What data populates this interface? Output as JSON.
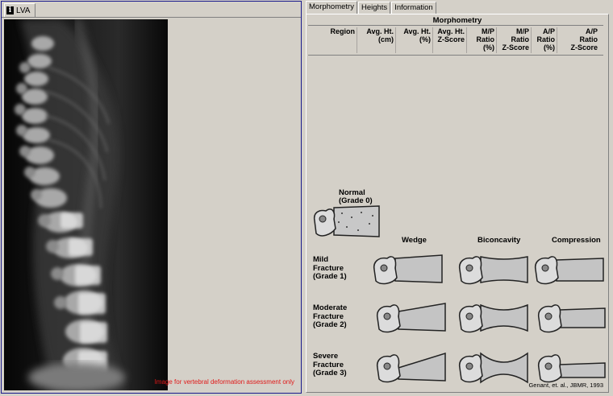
{
  "left_pane": {
    "tab_label": "LVA",
    "image_note": "Image for vertebral deformation assessment only"
  },
  "right_pane": {
    "tabs": [
      {
        "label": "Morphometry",
        "active": true
      },
      {
        "label": "Heights",
        "active": false
      },
      {
        "label": "Information",
        "active": false
      }
    ],
    "morphometry": {
      "title": "Morphometry",
      "columns": [
        "Region",
        "Avg. Ht.\n(cm)",
        "Avg. Ht.\n(%)",
        "Avg. Ht.\nZ-Score",
        "M/P\nRatio\n(%)",
        "M/P\nRatio\nZ-Score",
        "A/P\nRatio\n(%)",
        "A/P\nRatio\nZ-Score"
      ]
    },
    "fracture_chart": {
      "normal_label": "Normal\n(Grade 0)",
      "column_labels": [
        "Wedge",
        "Biconcavity",
        "Compression"
      ],
      "row_labels": [
        "Mild\nFracture\n(Grade 1)",
        "Moderate\nFracture\n(Grade 2)",
        "Severe\nFracture\n(Grade 3)"
      ],
      "citation": "Genant, et. al., JBMR, 1993"
    }
  }
}
